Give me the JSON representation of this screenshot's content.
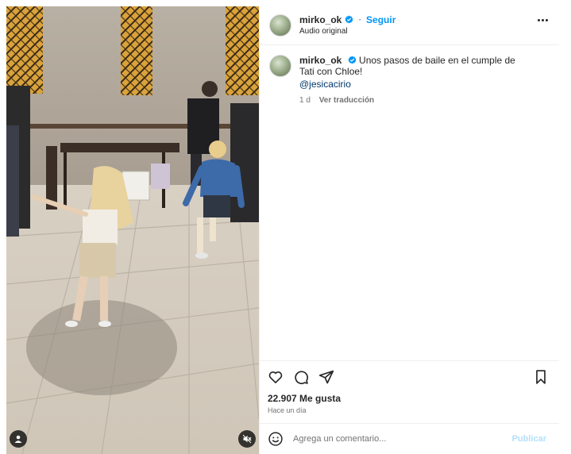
{
  "post": {
    "header": {
      "username": "mirko_ok",
      "separator": "·",
      "follow_label": "Seguir",
      "audio_label": "Audio original",
      "more_icon": "more-horizontal-icon"
    },
    "caption": {
      "username": "mirko_ok",
      "text": "Unos pasos de baile en el cumple de Tati con Chloe!",
      "mention": "@jesicacirio",
      "time": "1 d",
      "translate_label": "Ver traducción"
    },
    "actions": {
      "like_icon": "heart-icon",
      "comment_icon": "comment-icon",
      "share_icon": "share-icon",
      "save_icon": "bookmark-icon"
    },
    "likes_label": "22.907 Me gusta",
    "time_ago": "Hace un día",
    "comment_box": {
      "placeholder": "Agrega un comentario...",
      "publish_label": "Publicar"
    },
    "media": {
      "description_icons": [
        "user-tag-icon",
        "mute-icon"
      ]
    },
    "colors": {
      "link_blue": "#0095f6",
      "verified_blue": "#0095f6",
      "publish_disabled": "#b2dffc",
      "mention": "#00376b"
    }
  }
}
